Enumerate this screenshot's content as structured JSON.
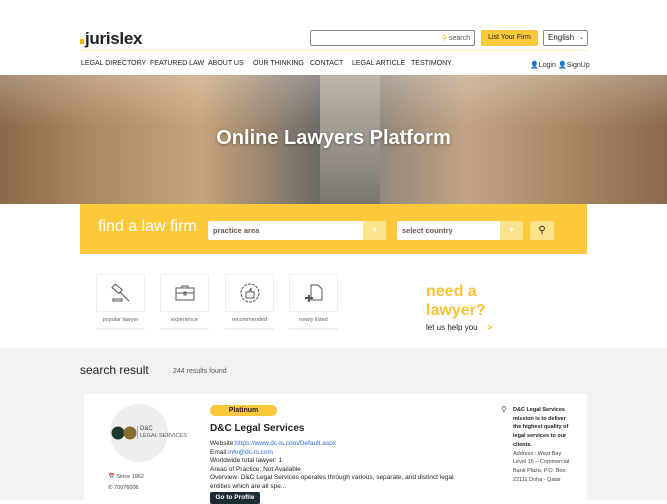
{
  "header": {
    "logo": "jurislex",
    "search_placeholder": "search",
    "list_firm": "List Your Firm",
    "language": "English",
    "nav": [
      "LEGAL DIRECTORY",
      "FEATURED LAW",
      "ABOUT US",
      "OUR THINKING",
      "CONTACT",
      "LEGAL ARTICLE",
      "TESTIMONY"
    ],
    "login": "Login",
    "signup": "SignUp"
  },
  "hero": {
    "title": "Online Lawyers Platform"
  },
  "find": {
    "title": "find a law firm",
    "practice": "practice area",
    "country": "select country"
  },
  "categories": [
    "popular lawyer",
    "experience",
    "recommended",
    "newly listed"
  ],
  "cta": {
    "line1": "need a",
    "line2": "lawyer?",
    "help": "let us help you",
    "arrow": ">"
  },
  "results": {
    "title": "search result",
    "count": "244 results found",
    "item": {
      "tier": "Platinum",
      "name": "D&C Legal Services",
      "logo_text": "D&C",
      "logo_sub": "LEGAL SERVICES",
      "since": "Since 1962",
      "phone": "70076006",
      "website_label": "Website:",
      "website": "https://www.dc-ls.com/Default.aspx",
      "email_label": "Email:",
      "email": "info@dc-ls.com",
      "lawyers": "Worldwide total lawyer:  1",
      "areas": "Areas of Practice: Not Available",
      "overview": "Overview: D&C Legal Services operates through various, separate, and distinct legal entities which are all spe...",
      "button": "Go to Profile",
      "mission": "D&C Legal Services mission is to deliver the highest quality of legal services to our clients.",
      "address": "Address : West Bay Level 15 – Commercial Bank Plaza, P.O. Box: 22111 Doha - Qatar"
    }
  },
  "colors": {
    "accent": "#fcc93a"
  }
}
